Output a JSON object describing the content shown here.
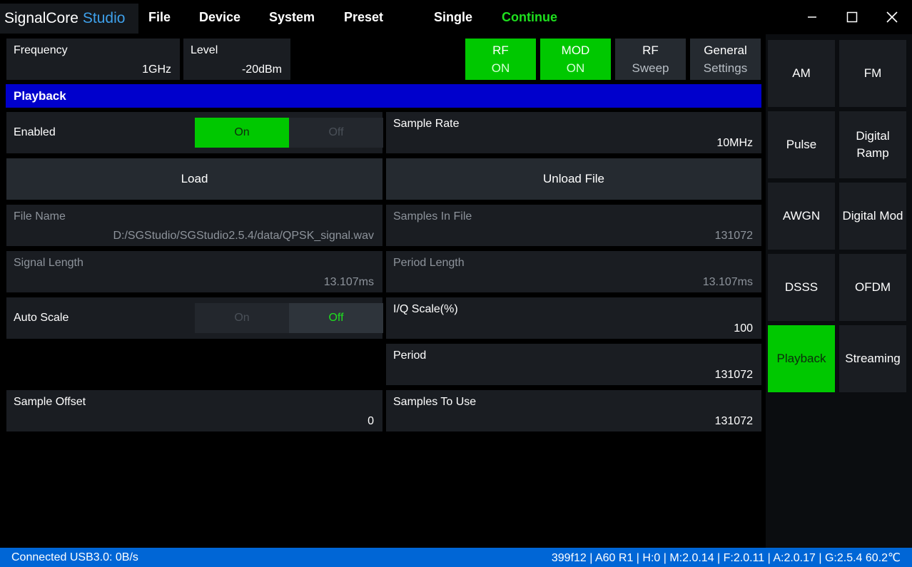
{
  "app": {
    "name_main": "SignalCore",
    "name_accent": "Studio"
  },
  "menu": {
    "file": "File",
    "device": "Device",
    "system": "System",
    "preset": "Preset",
    "single": "Single",
    "continue": "Continue"
  },
  "top": {
    "frequency": {
      "label": "Frequency",
      "value": "1GHz"
    },
    "level": {
      "label": "Level",
      "value": "-20dBm"
    },
    "buttons": [
      {
        "line1": "RF",
        "line2": "ON",
        "active": true
      },
      {
        "line1": "MOD",
        "line2": "ON",
        "active": true
      },
      {
        "line1": "RF",
        "line2": "Sweep",
        "active": false
      },
      {
        "line1": "General",
        "line2": "Settings",
        "active": false
      }
    ]
  },
  "section_title": "Playback",
  "playback": {
    "enabled": {
      "label": "Enabled",
      "on": "On",
      "off": "Off",
      "state": "on"
    },
    "sample_rate": {
      "label": "Sample Rate",
      "value": "10MHz"
    },
    "load": "Load",
    "unload": "Unload File",
    "file_name": {
      "label": "File Name",
      "value": "D:/SGStudio/SGStudio2.5.4/data/QPSK_signal.wav"
    },
    "samples_in_file": {
      "label": "Samples In File",
      "value": "131072"
    },
    "signal_length": {
      "label": "Signal Length",
      "value": "13.107ms"
    },
    "period_length": {
      "label": "Period Length",
      "value": "13.107ms"
    },
    "auto_scale": {
      "label": "Auto Scale",
      "on": "On",
      "off": "Off",
      "state": "off"
    },
    "iq_scale": {
      "label": "I/Q Scale(%)",
      "value": "100"
    },
    "period": {
      "label": "Period",
      "value": "131072"
    },
    "sample_offset": {
      "label": "Sample Offset",
      "value": "0"
    },
    "samples_to_use": {
      "label": "Samples To Use",
      "value": "131072"
    }
  },
  "sidebar": {
    "items": [
      {
        "label": "AM"
      },
      {
        "label": "FM"
      },
      {
        "label": "Pulse"
      },
      {
        "label": "Digital Ramp"
      },
      {
        "label": "AWGN"
      },
      {
        "label": "Digital Mod"
      },
      {
        "label": "DSSS"
      },
      {
        "label": "OFDM"
      },
      {
        "label": "Playback",
        "active": true
      },
      {
        "label": "Streaming"
      }
    ]
  },
  "status": {
    "left": "Connected USB3.0: 0B/s",
    "right": "399f12 | A60 R1 | H:0 | M:2.0.14 | F:2.0.11 | A:2.0.17 | G:2.5.4  60.2℃"
  },
  "colors": {
    "active_green": "#00c800",
    "header_blue": "#0000cc",
    "status_blue": "#0066d6",
    "accent_text": "#3ea0ea"
  }
}
